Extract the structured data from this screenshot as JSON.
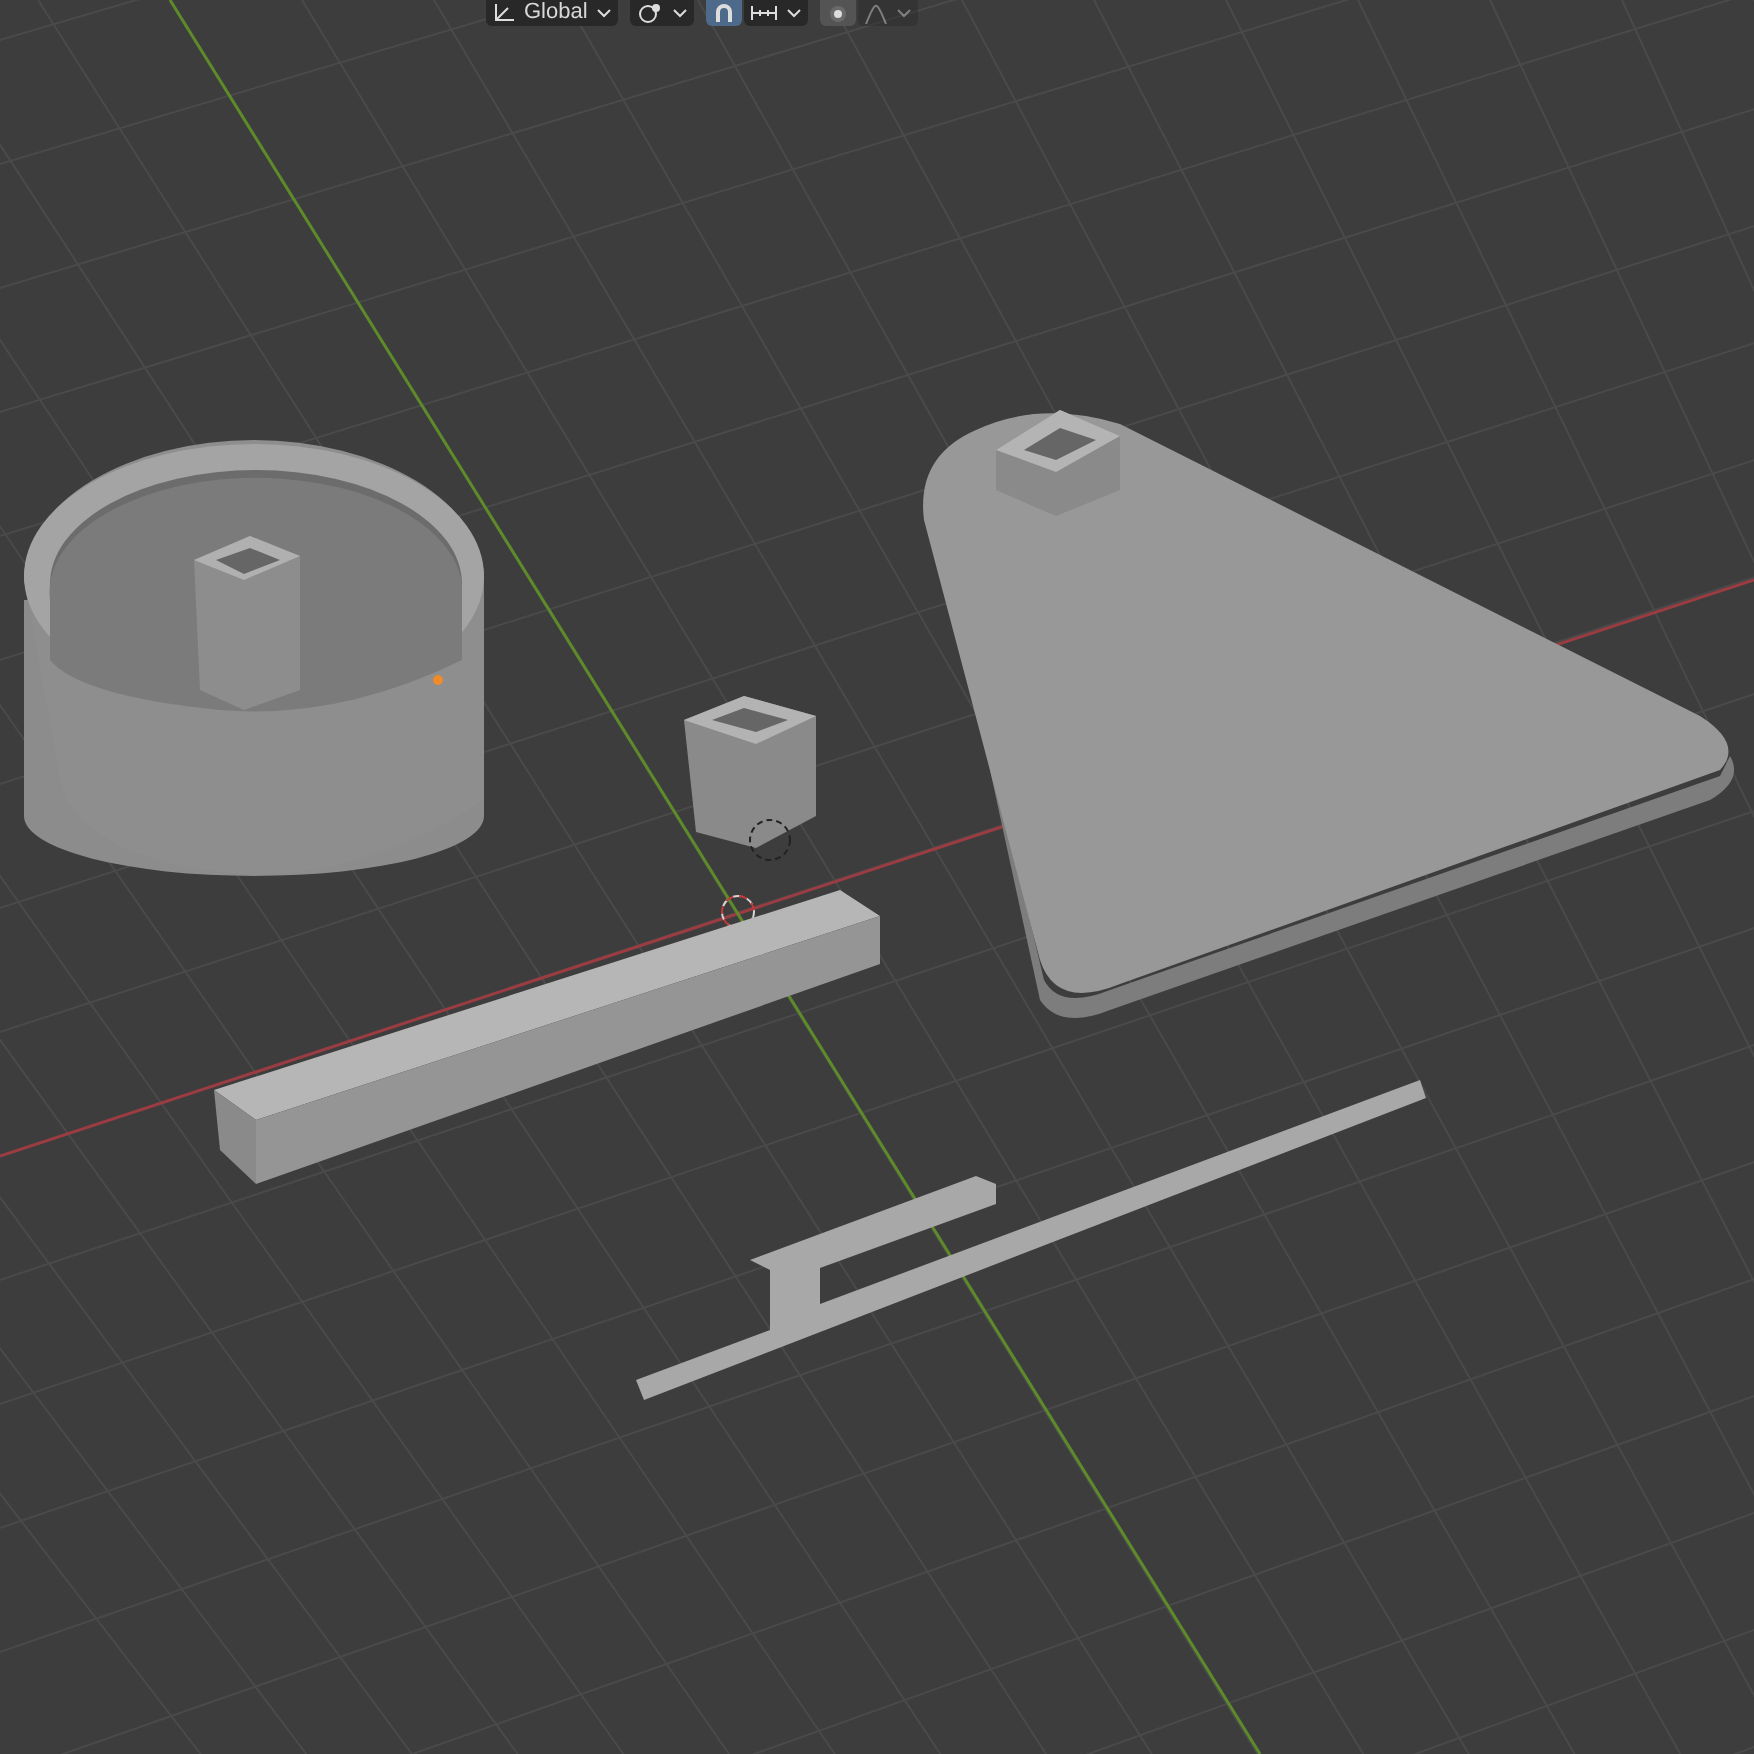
{
  "header": {
    "orientation": {
      "label": "Global"
    },
    "snap": {
      "on": true
    },
    "proportional": {
      "on": false
    }
  }
}
